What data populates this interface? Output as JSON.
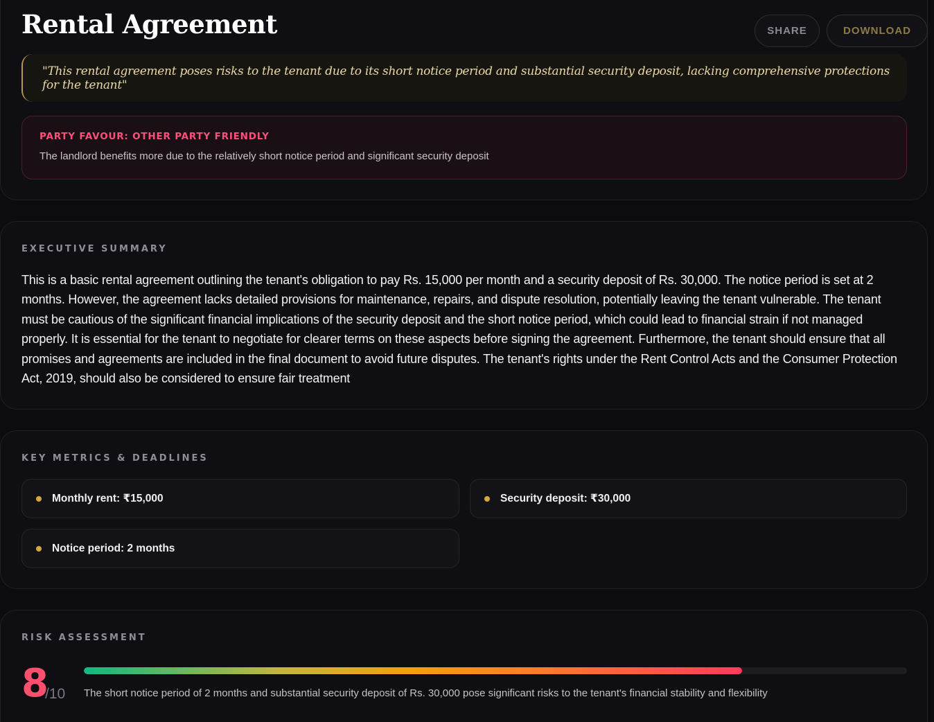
{
  "header": {
    "title": "Rental Agreement",
    "share_label": "SHARE",
    "download_label": "DOWNLOAD"
  },
  "verdict_quote": "\"This rental agreement poses risks to the tenant due to its short notice period and substantial security deposit, lacking comprehensive protections for the tenant\"",
  "party_favour": {
    "label": "PARTY FAVOUR: OTHER PARTY FRIENDLY",
    "text": "The landlord benefits more due to the relatively short notice period and significant security deposit"
  },
  "executive_summary": {
    "heading": "EXECUTIVE SUMMARY",
    "text": "This is a basic rental agreement outlining the tenant's obligation to pay Rs. 15,000 per month and a security deposit of Rs. 30,000. The notice period is set at 2 months. However, the agreement lacks detailed provisions for maintenance, repairs, and dispute resolution, potentially leaving the tenant vulnerable. The tenant must be cautious of the significant financial implications of the security deposit and the short notice period, which could lead to financial strain if not managed properly. It is essential for the tenant to negotiate for clearer terms on these aspects before signing the agreement. Furthermore, the tenant should ensure that all promises and agreements are included in the final document to avoid future disputes. The tenant's rights under the Rent Control Acts and the Consumer Protection Act, 2019, should also be considered to ensure fair treatment"
  },
  "key_metrics": {
    "heading": "KEY METRICS & DEADLINES",
    "items": [
      "Monthly rent: ₹15,000",
      "Security deposit: ₹30,000",
      "Notice period: 2 months"
    ]
  },
  "risk_assessment": {
    "heading": "RISK ASSESSMENT",
    "score": "8",
    "out_of": "/10",
    "bar_fill_fraction": 0.8,
    "text": "The short notice period of 2 months and substantial security deposit of Rs. 30,000 pose significant risks to the tenant's financial stability and flexibility"
  },
  "colors": {
    "accent_gold": "#d4a83a",
    "danger_pink": "#ff4f7b",
    "background": "#0c0c0f"
  }
}
